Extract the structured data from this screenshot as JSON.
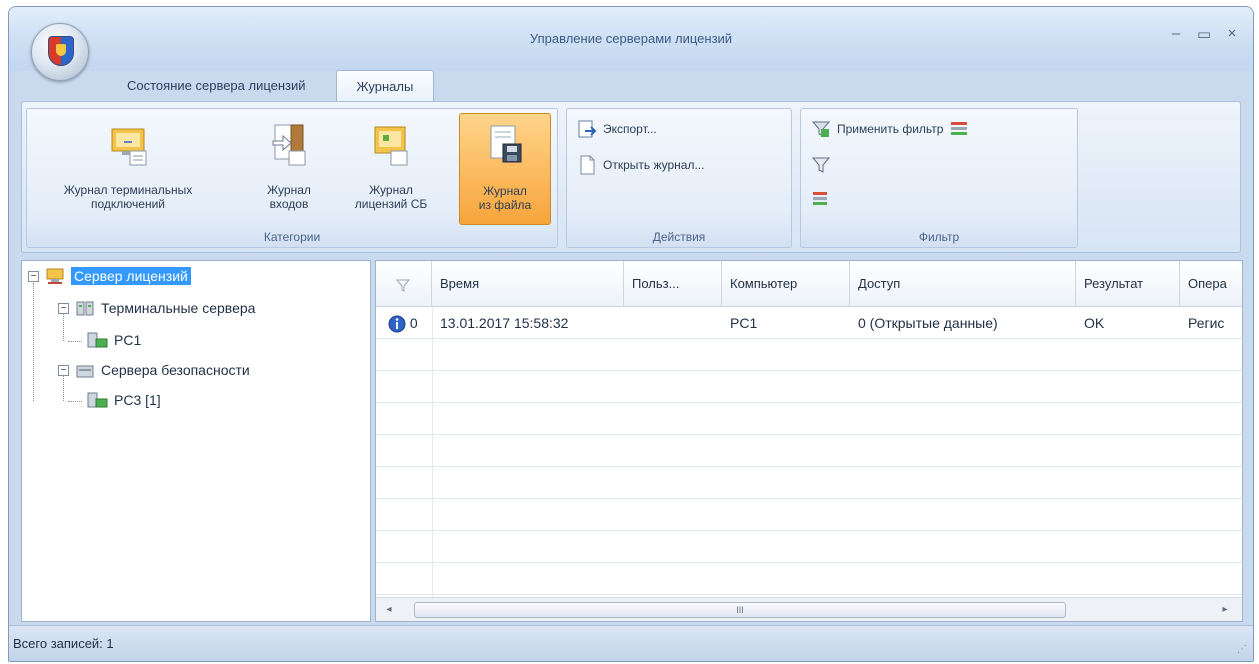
{
  "window": {
    "title": "Управление серверами лицензий",
    "controls": {
      "minimize": "–",
      "maximize": "▭",
      "close": "×"
    }
  },
  "tabs": [
    {
      "label": "Состояние сервера лицензий",
      "active": false
    },
    {
      "label": "Журналы",
      "active": true
    }
  ],
  "ribbon": {
    "categories": {
      "label": "Категории",
      "buttons": [
        {
          "label": "Журнал терминальных\nподключений"
        },
        {
          "label": "Журнал\nвходов"
        },
        {
          "label": "Журнал\nлицензий СБ"
        },
        {
          "label": "Журнал\nиз файла",
          "active": true
        }
      ]
    },
    "actions": {
      "label": "Действия",
      "export": "Экспорт...",
      "open_log": "Открыть журнал..."
    },
    "filter": {
      "label": "Фильтр",
      "apply": "Применить фильтр"
    }
  },
  "tree": {
    "root": "Сервер лицензий",
    "terminal_servers": "Терминальные сервера",
    "terminal_child": "PC1",
    "security_servers": "Сервера безопасности",
    "security_child": "PC3 [1]",
    "expander_symbol": "−"
  },
  "grid": {
    "columns": [
      "Время",
      "Польз...",
      "Компьютер",
      "Доступ",
      "Результат",
      "Опера"
    ],
    "rows": [
      {
        "level": "0",
        "time": "13.01.2017 15:58:32",
        "user": "",
        "computer": "PC1",
        "access": "0 (Открытые данные)",
        "result": "OK",
        "operation": "Регис"
      }
    ],
    "scroll": {
      "left": "◂",
      "right": "▸",
      "thumb": "III"
    }
  },
  "status": {
    "text": "Всего записей: 1"
  },
  "colors": {
    "accent_active": "#f7a43c",
    "selection": "#3399ff",
    "window_frame": "#c9daef"
  }
}
